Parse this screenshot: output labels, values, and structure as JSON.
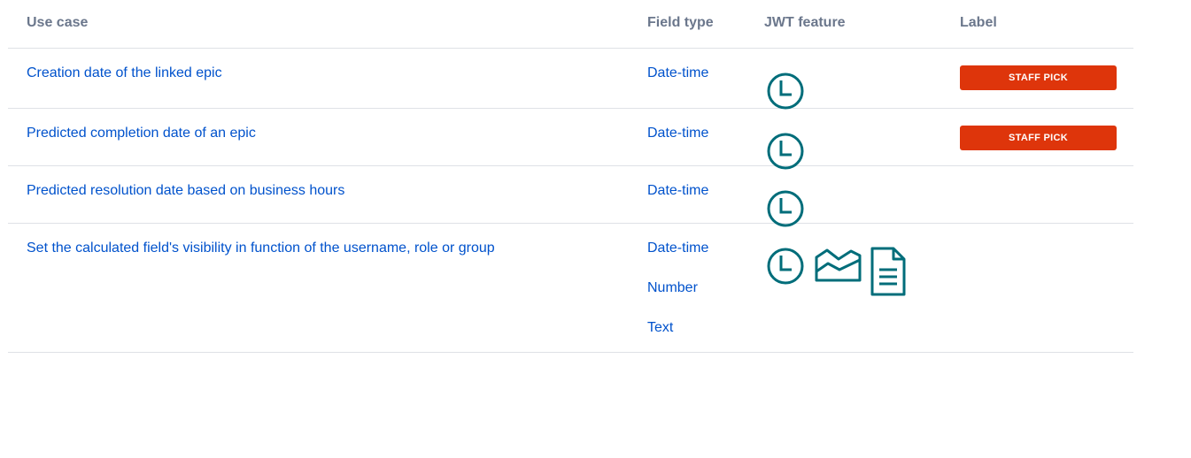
{
  "header": {
    "use_case": "Use case",
    "field_type": "Field type",
    "jwt_feature": "JWT feature",
    "label": "Label"
  },
  "rows": [
    {
      "use_case": "Creation date of the linked epic",
      "field_types": [
        "Date-time"
      ],
      "features": [
        "clock-icon"
      ],
      "label": "STAFF PICK"
    },
    {
      "use_case": "Predicted completion date of an epic",
      "field_types": [
        "Date-time"
      ],
      "features": [
        "clock-icon"
      ],
      "label": "STAFF PICK"
    },
    {
      "use_case": "Predicted resolution date based on business hours",
      "field_types": [
        "Date-time"
      ],
      "features": [
        "clock-icon"
      ],
      "label": ""
    },
    {
      "use_case": "Set the calculated field's visibility in function of the username, role or group",
      "field_types": [
        "Date-time",
        "Number",
        "Text"
      ],
      "features": [
        "clock-icon",
        "chart-icon",
        "document-icon"
      ],
      "label": ""
    }
  ],
  "colors": {
    "link": "#0052cc",
    "header_text": "#6b778c",
    "badge_bg": "#de350b",
    "icon": "#006d7a",
    "divider": "#dfe1e6"
  }
}
